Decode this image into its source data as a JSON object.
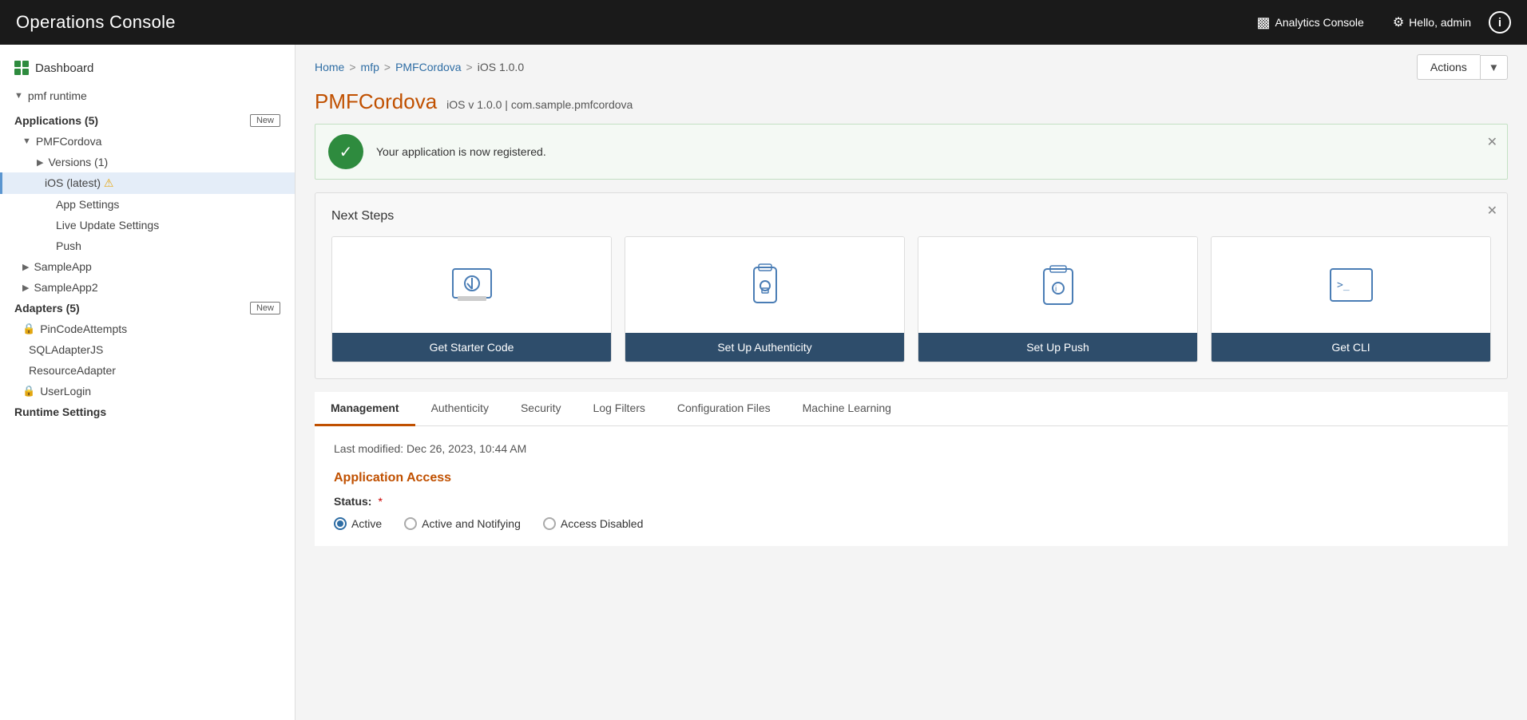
{
  "header": {
    "title": "Operations Console",
    "analytics_label": "Analytics Console",
    "user_label": "Hello, admin",
    "info_label": "i"
  },
  "sidebar": {
    "dashboard_label": "Dashboard",
    "runtime_label": "pmf runtime",
    "applications_label": "Applications",
    "applications_count": "(5)",
    "applications_badge": "New",
    "pmfcordova_label": "PMFCordova",
    "versions_label": "Versions (1)",
    "ios_label": "iOS (latest)",
    "app_settings_label": "App Settings",
    "live_update_label": "Live Update Settings",
    "push_label": "Push",
    "sampleapp_label": "SampleApp",
    "sampleapp2_label": "SampleApp2",
    "adapters_label": "Adapters",
    "adapters_count": "(5)",
    "adapters_badge": "New",
    "pincode_label": "PinCodeAttempts",
    "sqladapter_label": "SQLAdapterJS",
    "resource_label": "ResourceAdapter",
    "userlogin_label": "UserLogin",
    "runtime_settings_label": "Runtime Settings"
  },
  "breadcrumb": {
    "home": "Home",
    "mfp": "mfp",
    "pmfcordova": "PMFCordova",
    "ios": "iOS 1.0.0"
  },
  "actions": {
    "label": "Actions"
  },
  "page": {
    "title": "PMFCordova",
    "subtitle": "iOS v 1.0.0 | com.sample.pmfcordova"
  },
  "banner": {
    "message": "Your application is now registered."
  },
  "next_steps": {
    "title": "Next Steps",
    "items": [
      {
        "label": "Get Starter Code"
      },
      {
        "label": "Set Up Authenticity"
      },
      {
        "label": "Set Up Push"
      },
      {
        "label": "Get CLI"
      }
    ]
  },
  "tabs": {
    "items": [
      {
        "label": "Management",
        "active": true
      },
      {
        "label": "Authenticity"
      },
      {
        "label": "Security"
      },
      {
        "label": "Log Filters"
      },
      {
        "label": "Configuration Files"
      },
      {
        "label": "Machine Learning"
      }
    ]
  },
  "management": {
    "last_modified": "Last modified: Dec 26, 2023, 10:44 AM",
    "section_title": "Application Access",
    "status_label": "Status:",
    "radio_options": [
      {
        "label": "Active",
        "selected": true
      },
      {
        "label": "Active and Notifying",
        "selected": false
      },
      {
        "label": "Access Disabled",
        "selected": false
      }
    ]
  }
}
